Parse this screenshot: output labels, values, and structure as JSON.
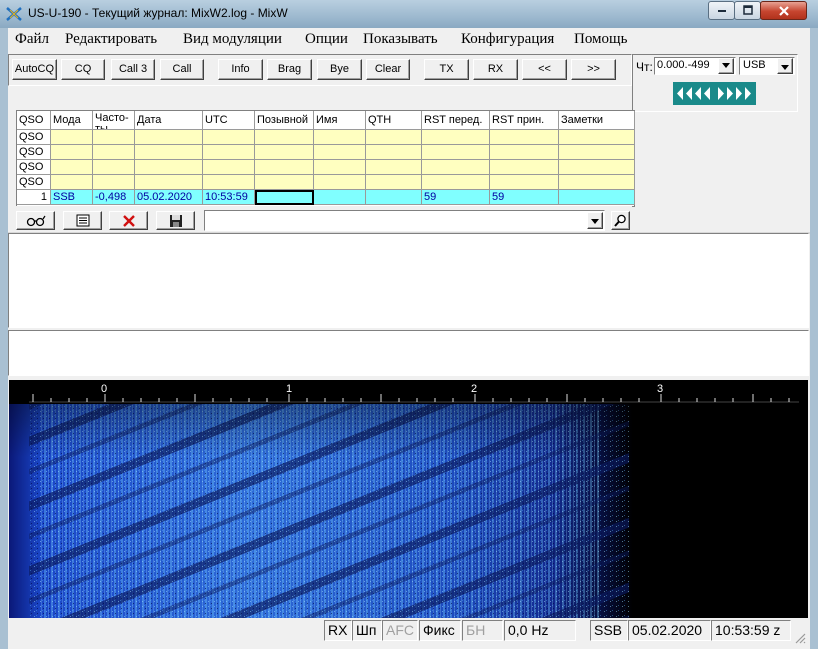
{
  "window": {
    "title": "US-U-190 - Текущий журнал: MixW2.log - MixW"
  },
  "menu": [
    "Файл",
    "Редактировать",
    "Вид модуляции",
    "Опции",
    "Показывать",
    "Конфигурация",
    "Помощь"
  ],
  "toolbar": {
    "buttons": [
      "AutoCQ",
      "CQ",
      "Call 3",
      "Call",
      "Info",
      "Brag",
      "Bye",
      "Clear",
      "TX",
      "RX",
      "<<",
      ">>"
    ]
  },
  "frequency": {
    "label": "Чт:",
    "value": "0.000.-499",
    "mode": "USB"
  },
  "log": {
    "columns": [
      "QSO",
      "Мода",
      "Часто- ты",
      "Дата",
      "UTC",
      "Позывной",
      "Имя",
      "QTH",
      "RST перед.",
      "RST прин.",
      "Заметки"
    ],
    "empty_rows": [
      "QSO",
      "QSO",
      "QSO",
      "QSO"
    ],
    "current": {
      "num": "1",
      "mode": "SSB",
      "freq": "-0,498",
      "date": "05.02.2020",
      "utc": "10:53:59",
      "call": "",
      "name": "",
      "qth": "",
      "rst_sent": "59",
      "rst_rcvd": "59",
      "notes": ""
    }
  },
  "waterfall": {
    "scale": [
      "0",
      "1",
      "2",
      "3"
    ],
    "marker": "7"
  },
  "status": {
    "rx": "RX",
    "width": "Шп",
    "afc": "AFC",
    "fix": "Фикс",
    "bn": "БН",
    "offset": "0,0 Hz",
    "mode": "SSB",
    "date": "05.02.2020",
    "time": "10:53:59 z"
  },
  "colors": {
    "title_bar": "#9db9cf",
    "log_highlight": "#80ffff",
    "log_empty": "#ffffc0",
    "tune_button": "#1a8a8a"
  }
}
